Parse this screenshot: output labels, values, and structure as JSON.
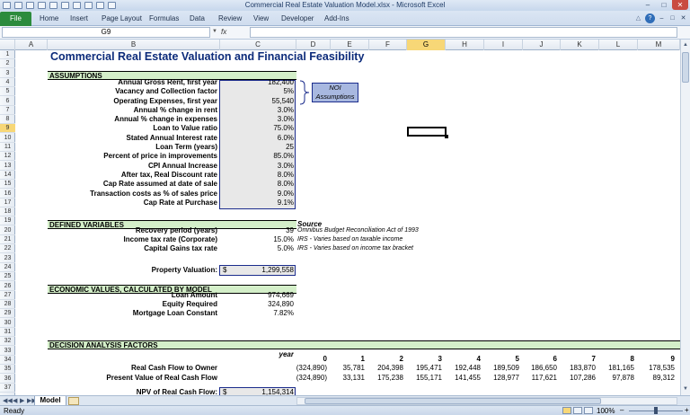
{
  "window": {
    "title": "Commercial Real Estate Valuation Model.xlsx  -  Microsoft Excel",
    "minimize_icon": "minimize-icon",
    "maximize_icon": "maximize-icon",
    "close_icon": "close-icon"
  },
  "ribbon": {
    "file_label": "File",
    "tabs": [
      "Home",
      "Insert",
      "Page Layout",
      "Formulas",
      "Data",
      "Review",
      "View",
      "Developer",
      "Add-Ins"
    ]
  },
  "formula_bar": {
    "name_box": "G9",
    "fx_label": "fx",
    "formula": ""
  },
  "columns": [
    "A",
    "B",
    "C",
    "D",
    "E",
    "F",
    "G",
    "H",
    "I",
    "J",
    "K",
    "L",
    "M"
  ],
  "selected_column": "G",
  "rows": [
    "1",
    "2",
    "3",
    "4",
    "5",
    "6",
    "7",
    "8",
    "9",
    "10",
    "11",
    "12",
    "13",
    "14",
    "15",
    "16",
    "17",
    "18",
    "19",
    "20",
    "21",
    "22",
    "23",
    "24",
    "25",
    "26",
    "27",
    "28",
    "29",
    "30",
    "31",
    "32",
    "33",
    "34",
    "35",
    "36",
    "37"
  ],
  "selected_row": "9",
  "sheet": {
    "title": "Commercial Real Estate Valuation and Financial Feasibility",
    "sections": {
      "assumptions": "ASSUMPTIONS",
      "defined_variables": "DEFINED VARIABLES",
      "economic_values": "ECONOMIC VALUES, CALCULATED BY MODEL",
      "decision_analysis": "DECISION ANALYSIS FACTORS"
    },
    "assumptions": [
      {
        "label": "Annual Gross Rent, first year",
        "value": "182,400"
      },
      {
        "label": "Vacancy and Collection factor",
        "value": "5%"
      },
      {
        "label": "Operating Expenses, first year",
        "value": "55,540"
      },
      {
        "label": "Annual % change in rent",
        "value": "3.0%"
      },
      {
        "label": "Annual % change in expenses",
        "value": "3.0%"
      },
      {
        "label": "Loan to Value ratio",
        "value": "75.0%"
      },
      {
        "label": "Stated Annual Interest rate",
        "value": "6.0%"
      },
      {
        "label": "Loan Term (years)",
        "value": "25"
      },
      {
        "label": "Percent of price in improvements",
        "value": "85.0%"
      },
      {
        "label": "CPI Annual Increase",
        "value": "3.0%"
      },
      {
        "label": "After tax, Real Discount rate",
        "value": "8.0%"
      },
      {
        "label": "Cap Rate assumed at date of sale",
        "value": "8.0%"
      },
      {
        "label": "Transaction costs as % of sales price",
        "value": "9.0%"
      },
      {
        "label": "Cap Rate at Purchase",
        "value": "9.1%"
      }
    ],
    "noi_note": "NOI Assumptions",
    "source_header": "Source",
    "defined_variables": [
      {
        "label": "Recovery period (years)",
        "value": "39",
        "source": "Omnibus Budget Reconciliation Act of 1993"
      },
      {
        "label": "Income tax rate (Corporate)",
        "value": "15.0%",
        "source": "IRS - Varies based on taxable income"
      },
      {
        "label": "Capital Gains tax rate",
        "value": "5.0%",
        "source": "IRS - Varies based on income tax bracket"
      }
    ],
    "property_valuation": {
      "label": "Property Valuation:",
      "currency": "$",
      "value": "1,299,558"
    },
    "economic_values": [
      {
        "label": "Loan Amount",
        "value": "974,669"
      },
      {
        "label": "Equity Required",
        "value": "324,890"
      },
      {
        "label": "Mortgage Loan Constant",
        "value": "7.82%"
      }
    ],
    "year_label": "year",
    "years": [
      "0",
      "1",
      "2",
      "3",
      "4",
      "5",
      "6",
      "7",
      "8",
      "9"
    ],
    "cash_flow_rows": [
      {
        "label": "Real Cash Flow to Owner",
        "values": [
          "(324,890)",
          "35,781",
          "204,398",
          "195,471",
          "192,448",
          "189,509",
          "186,650",
          "183,870",
          "181,165",
          "178,535"
        ]
      },
      {
        "label": "Present Value of Real Cash Flow",
        "values": [
          "(324,890)",
          "33,131",
          "175,238",
          "155,171",
          "141,455",
          "128,977",
          "117,621",
          "107,286",
          "97,878",
          "89,312"
        ]
      }
    ],
    "npv": {
      "label": "NPV of Real Cash Flow:",
      "currency": "$",
      "value": "1,154,314"
    }
  },
  "sheet_tabs": {
    "active": "Model",
    "nav_icons": [
      "first-sheet-icon",
      "prev-sheet-icon",
      "next-sheet-icon",
      "last-sheet-icon"
    ]
  },
  "status_bar": {
    "status": "Ready",
    "zoom": "100%"
  },
  "colors": {
    "file_tab": "#2c8b3c",
    "section_band": "#d4efc9",
    "title_text": "#0c2b7a",
    "input_box_border": "#1b2c8c",
    "noi_box": "#a8b8e0",
    "selection": "#f7d777"
  }
}
